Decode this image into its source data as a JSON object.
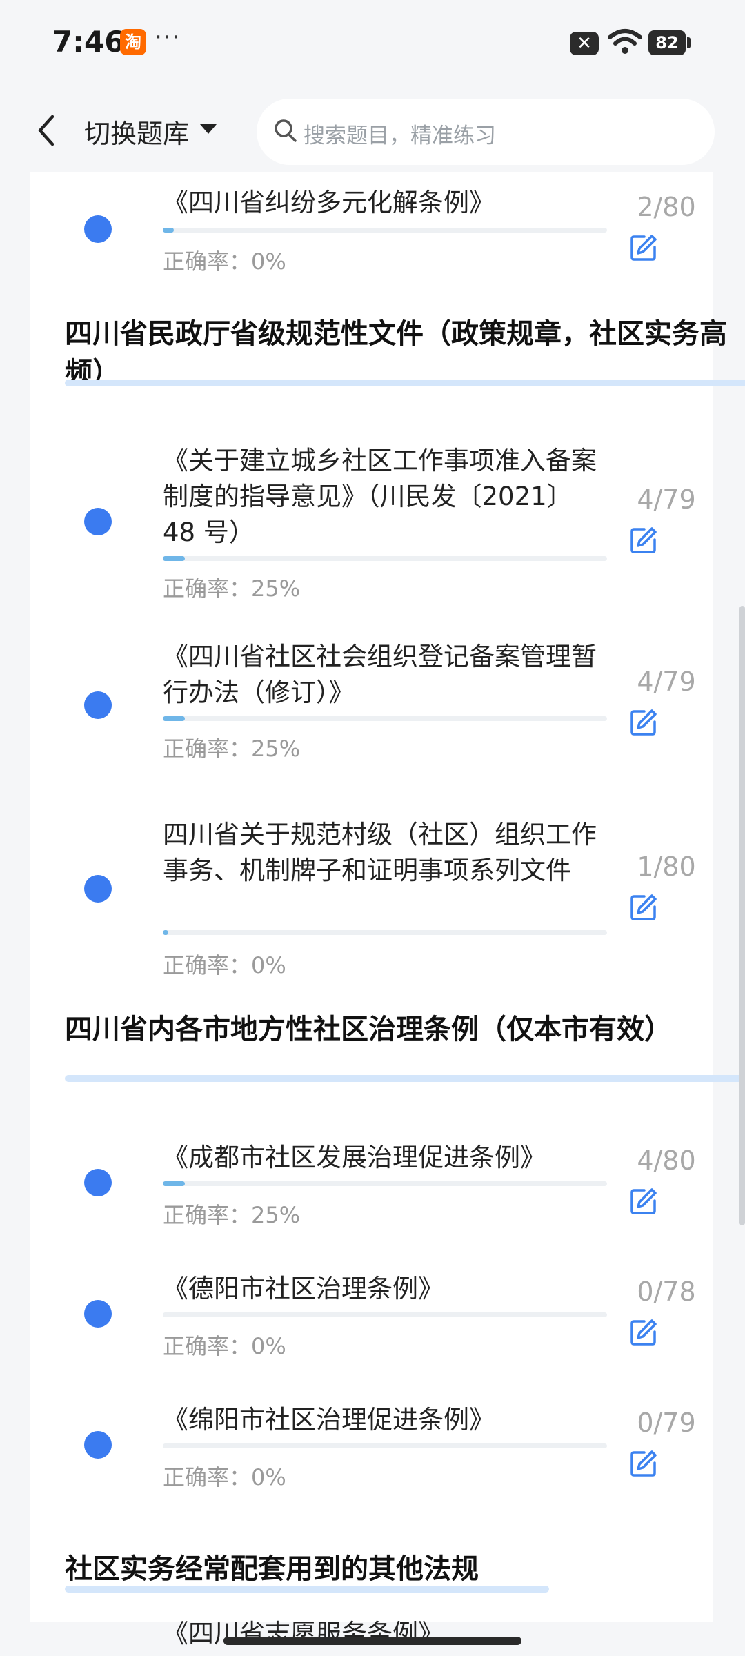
{
  "status_bar": {
    "time": "7:46",
    "app_badge": "淘",
    "more": "···",
    "close_badge": "✕",
    "battery": "82"
  },
  "header": {
    "switch_label": "切换题库",
    "search_placeholder": "搜索题目，精准练习"
  },
  "items_top": [
    {
      "title": "《四川省纠纷多元化解条例》",
      "accuracy": "正确率：0%",
      "count": "2/80",
      "progress": 0.025
    }
  ],
  "sections": [
    {
      "title": "四川省民政厅省级规范性文件（政策规章，社区实务高频）",
      "items": [
        {
          "title": "《关于建立城乡社区工作事项准入备案制度的指导意见》（川民发〔2021〕48 号）",
          "accuracy": "正确率：25%",
          "count": "4/79",
          "progress": 0.05
        },
        {
          "title": "《四川省社区社会组织登记备案管理暂行办法（修订）》",
          "accuracy": "正确率：25%",
          "count": "4/79",
          "progress": 0.05
        },
        {
          "title": "四川省关于规范村级（社区）组织工作事务、机制牌子和证明事项系列文件",
          "accuracy": "正确率：0%",
          "count": "1/80",
          "progress": 0.0125
        }
      ]
    },
    {
      "title": "四川省内各市地方性社区治理条例（仅本市有效）",
      "items": [
        {
          "title": "《成都市社区发展治理促进条例》",
          "accuracy": "正确率：25%",
          "count": "4/80",
          "progress": 0.05
        },
        {
          "title": "《德阳市社区治理条例》",
          "accuracy": "正确率：0%",
          "count": "0/78",
          "progress": 0
        },
        {
          "title": "《绵阳市社区治理促进条例》",
          "accuracy": "正确率：0%",
          "count": "0/79",
          "progress": 0
        }
      ]
    },
    {
      "title": "社区实务经常配套用到的其他法规",
      "items": [
        {
          "title": "《四川省志愿服务条例》"
        }
      ]
    }
  ],
  "colors": {
    "dot": "#3b7bf0",
    "progress_fill": "#6fb6e8",
    "section_underline": "#d4e6fb",
    "edit_icon": "#3b82f0"
  }
}
